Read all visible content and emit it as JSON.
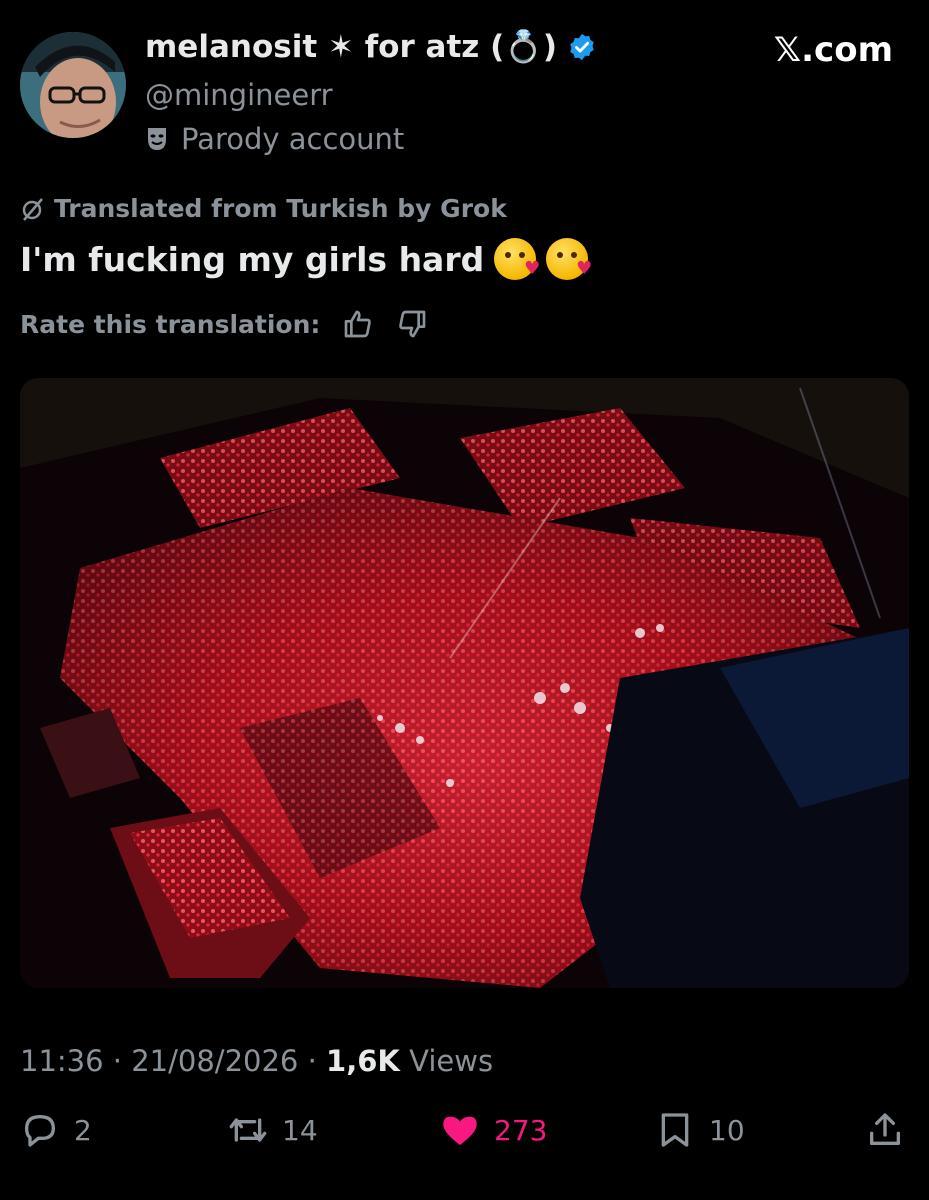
{
  "post": {
    "display_name": "melanosit ✶ for atz (💍)",
    "handle": "@mingineerr",
    "parody_label": "Parody account",
    "site": "𝕏.com",
    "translated_label": "Translated from Turkish by Grok",
    "text": "I'm fucking my girls hard",
    "emojis": [
      "face-blowing-kiss",
      "face-blowing-kiss"
    ],
    "rate_label": "Rate this translation:"
  },
  "meta": {
    "time": "11:36",
    "separator": "·",
    "date": "21/08/2026",
    "views_count": "1,6K",
    "views_label": "Views"
  },
  "actions": {
    "replies": "2",
    "reposts": "14",
    "likes": "273",
    "bookmarks": "10"
  },
  "colors": {
    "background": "#000000",
    "text": "#e7e9ea",
    "secondary": "#8b9299",
    "verified": "#1d9bf0",
    "like": "#f91880",
    "crowd": "#e8283c"
  },
  "icons": [
    "verified-badge-icon",
    "parody-mask-icon",
    "translate-icon",
    "thumbs-up-icon",
    "thumbs-down-icon",
    "reply-icon",
    "repost-icon",
    "heart-icon",
    "bookmark-icon",
    "share-icon"
  ]
}
